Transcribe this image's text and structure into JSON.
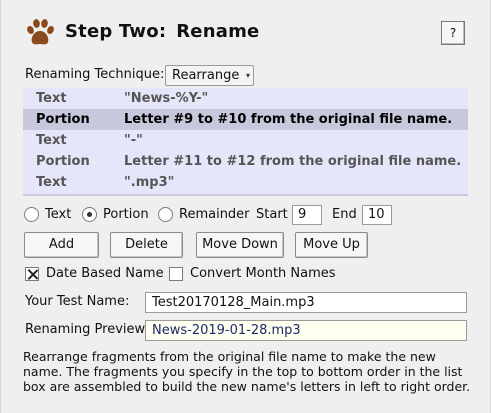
{
  "header": {
    "step": "Step Two:",
    "title": "Rename",
    "help_label": "?",
    "icon": "paw-print-icon",
    "icon_color": "#8b4a1d"
  },
  "technique": {
    "label": "Renaming Technique:",
    "selected": "Rearrange"
  },
  "fragments": [
    {
      "type": "Text",
      "value": "\"News-%Y-\"",
      "selected": false
    },
    {
      "type": "Portion",
      "value": "Letter #9 to #10 from the original file name.",
      "selected": true
    },
    {
      "type": "Text",
      "value": "\"-\"",
      "selected": false
    },
    {
      "type": "Portion",
      "value": "Letter #11 to #12 from the original file name.",
      "selected": false
    },
    {
      "type": "Text",
      "value": "\".mp3\"",
      "selected": false
    }
  ],
  "fragment_kind": {
    "options": [
      "Text",
      "Portion",
      "Remainder"
    ],
    "selected": "Portion",
    "start_label": "Start",
    "start_value": "9",
    "end_label": "End",
    "end_value": "10"
  },
  "buttons": {
    "add": "Add",
    "delete": "Delete",
    "move_down": "Move Down",
    "move_up": "Move Up"
  },
  "options": {
    "date_based_label": "Date Based Name",
    "date_based_checked": true,
    "convert_month_label": "Convert Month Names",
    "convert_month_checked": false
  },
  "test_name": {
    "label": "Your Test Name:",
    "value": "Test20170128_Main.mp3"
  },
  "preview": {
    "label": "Renaming Preview:",
    "value": "News-2019-01-28.mp3"
  },
  "help_text": "Rearrange fragments from the original file name to make the new name.  The fragments you specify in the top to bottom order in the list box are assembled to build the new name's letters in left to right order."
}
